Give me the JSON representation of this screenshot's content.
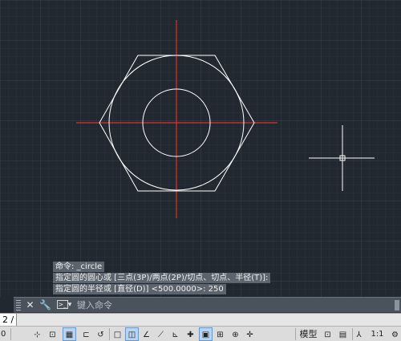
{
  "canvas": {
    "background": "#212830",
    "grid_color": "#2f3843",
    "crosshair_color": "#e03030",
    "geometry_color": "#ffffff"
  },
  "command_history": [
    "命令: _circle",
    "指定圆的圆心或 [三点(3P)/两点(2P)/切点、切点、半径(T)]:",
    "指定圆的半径或 [直径(D)] <500.0000>: 250"
  ],
  "command_line": {
    "icons": [
      "close-icon",
      "wrench-icon",
      "command-prompt-icon"
    ],
    "placeholder": "键入命令"
  },
  "layout_tab": {
    "label": "2 /"
  },
  "status_bar": {
    "coordinate": "0",
    "model_label": "模型",
    "annotation_scale": "1:1"
  }
}
